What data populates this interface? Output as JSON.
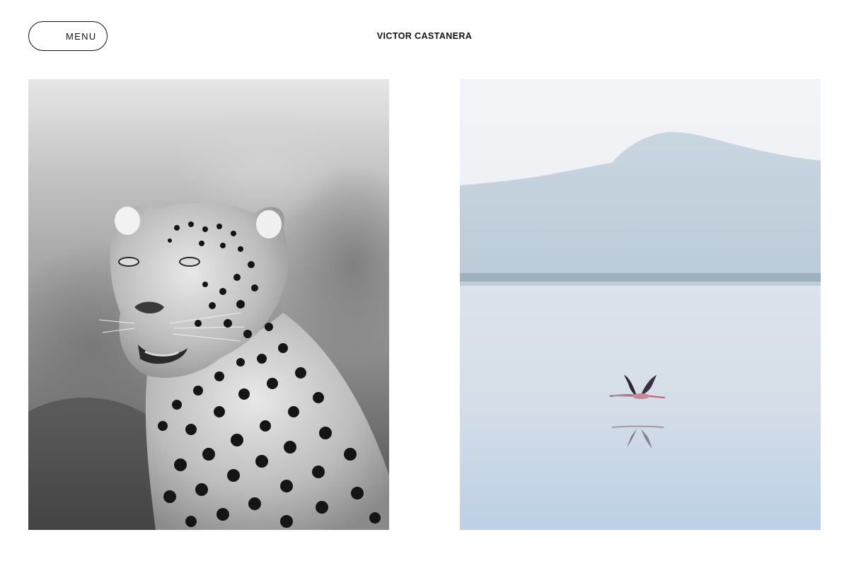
{
  "header": {
    "menu_label": "MENU",
    "site_title": "VICTOR CASTANERA"
  },
  "gallery": {
    "items": [
      {
        "subject": "leopard",
        "tone": "black-and-white"
      },
      {
        "subject": "flamingo",
        "tone": "pale-blue"
      }
    ]
  },
  "colors": {
    "text": "#111111",
    "background": "#ffffff",
    "border": "#111111",
    "flamingo_pink": "#c9889a",
    "sky_blue": "#dde6ee"
  }
}
